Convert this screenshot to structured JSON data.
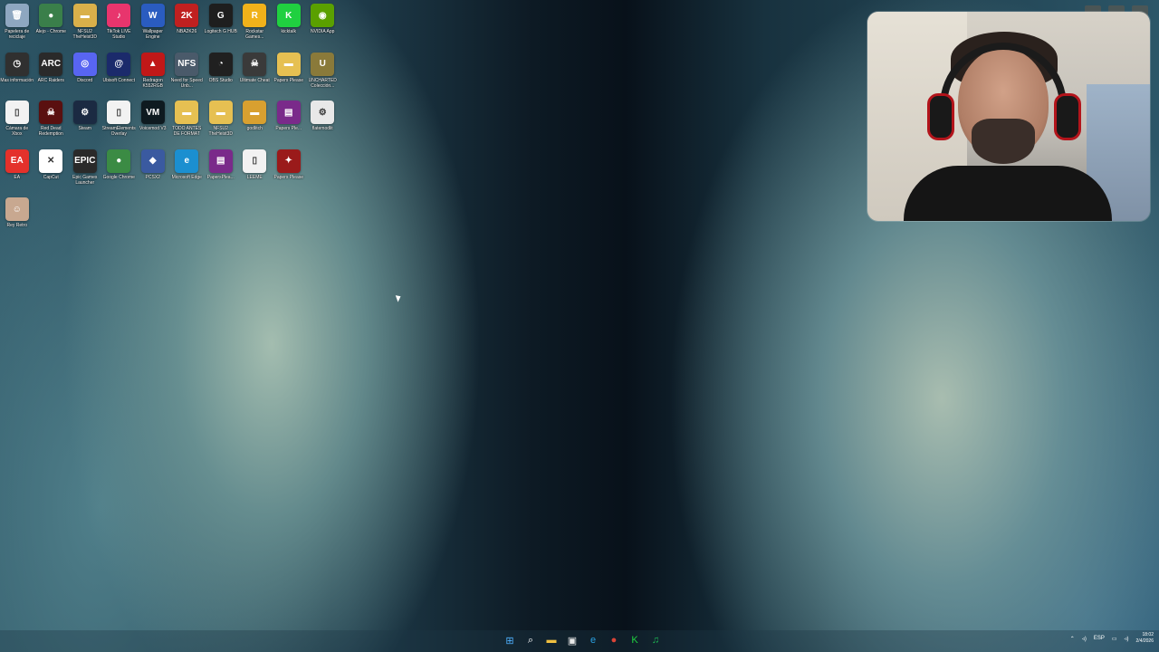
{
  "desktop": {
    "icons": [
      {
        "label": "Papelera de reciclaje",
        "icon": "recycle-bin-icon",
        "color": "#8ea7c0",
        "glyph": "🗑"
      },
      {
        "label": "Alejo - Chrome",
        "icon": "chrome-icon",
        "color": "#3a7f4a",
        "glyph": "●"
      },
      {
        "label": "NFSU2 TheHeist3D",
        "icon": "folder-icon",
        "color": "#d9b04a",
        "glyph": "▬"
      },
      {
        "label": "TikTok LIVE Studio",
        "icon": "tiktok-icon",
        "color": "#e8356d",
        "glyph": "♪"
      },
      {
        "label": "Wallpaper Engine",
        "icon": "wallpaper-engine-icon",
        "color": "#2a5cc0",
        "glyph": "W"
      },
      {
        "label": "NBA2K26",
        "icon": "nba2k-icon",
        "color": "#c02020",
        "glyph": "2K"
      },
      {
        "label": "Logitech G HUB",
        "icon": "logitech-icon",
        "color": "#1e1e1e",
        "glyph": "G"
      },
      {
        "label": "Rockstar Games...",
        "icon": "rockstar-icon",
        "color": "#f0b21a",
        "glyph": "R"
      },
      {
        "label": "kicktalk",
        "icon": "kick-icon",
        "color": "#20d040",
        "glyph": "K"
      },
      {
        "label": "NVIDIA App",
        "icon": "nvidia-icon",
        "color": "#5aa000",
        "glyph": "◉"
      },
      {
        "label": "Mas información",
        "icon": "clock-icon",
        "color": "#303030",
        "glyph": "◷"
      },
      {
        "label": "ARC Raiders",
        "icon": "arc-raiders-icon",
        "color": "#2a2a2a",
        "glyph": "ARC"
      },
      {
        "label": "Discord",
        "icon": "discord-icon",
        "color": "#5865f2",
        "glyph": "◎"
      },
      {
        "label": "Ubisoft Connect",
        "icon": "ubisoft-icon",
        "color": "#1b2a6b",
        "glyph": "@"
      },
      {
        "label": "Redragon K552RGB",
        "icon": "redragon-icon",
        "color": "#c01818",
        "glyph": "▲"
      },
      {
        "label": "Need for Speed Unb...",
        "icon": "nfs-icon",
        "color": "#4a5a6a",
        "glyph": "NFS"
      },
      {
        "label": "OBS Studio",
        "icon": "obs-icon",
        "color": "#202020",
        "glyph": "◔"
      },
      {
        "label": "Ultimate Cheat",
        "icon": "cheat-icon",
        "color": "#3a3a3a",
        "glyph": "☠"
      },
      {
        "label": "Papers Please",
        "icon": "folder-icon",
        "color": "#e6c052",
        "glyph": "▬"
      },
      {
        "label": "UNCHARTED Colección...",
        "icon": "uncharted-icon",
        "color": "#8a7a3a",
        "glyph": "U"
      },
      {
        "label": "Cámara de Xbox",
        "icon": "file-icon",
        "color": "#f2f2f2",
        "glyph": "▯"
      },
      {
        "label": "Red Dead Redemption",
        "icon": "rdr-icon",
        "color": "#5a1010",
        "glyph": "☠"
      },
      {
        "label": "Steam",
        "icon": "steam-icon",
        "color": "#1b2a42",
        "glyph": "⚙"
      },
      {
        "label": "StreamElements Overlay",
        "icon": "file-icon",
        "color": "#f2f2f2",
        "glyph": "▯"
      },
      {
        "label": "Voicemod V3",
        "icon": "voicemod-icon",
        "color": "#0e1a20",
        "glyph": "VM"
      },
      {
        "label": "TODO ANTES DE FORMAT",
        "icon": "folder-icon",
        "color": "#e6c052",
        "glyph": "▬"
      },
      {
        "label": "NFSU2 TheHeist3D",
        "icon": "folder-icon",
        "color": "#e6c052",
        "glyph": "▬"
      },
      {
        "label": "godlitch",
        "icon": "folder-icon",
        "color": "#d8a030",
        "glyph": "▬"
      },
      {
        "label": "Papers Ple...",
        "icon": "winrar-icon",
        "color": "#7a2a8a",
        "glyph": "▤"
      },
      {
        "label": "flatemodlit",
        "icon": "file-icon",
        "color": "#e8e8e8",
        "glyph": "⚙"
      },
      {
        "label": "EA",
        "icon": "ea-icon",
        "color": "#e4312b",
        "glyph": "EA"
      },
      {
        "label": "CapCut",
        "icon": "capcut-icon",
        "color": "#ffffff",
        "glyph": "✕"
      },
      {
        "label": "Epic Games Launcher",
        "icon": "epic-icon",
        "color": "#2a2a2a",
        "glyph": "EPIC"
      },
      {
        "label": "Google Chrome",
        "icon": "chrome-icon",
        "color": "#3b8b44",
        "glyph": "●"
      },
      {
        "label": "PCSX2",
        "icon": "pcsx2-icon",
        "color": "#3a5aa0",
        "glyph": "◆"
      },
      {
        "label": "Microsoft Edge",
        "icon": "edge-icon",
        "color": "#1b8fd0",
        "glyph": "e"
      },
      {
        "label": "PapersPlea...",
        "icon": "winrar-icon",
        "color": "#7a2a8a",
        "glyph": "▤"
      },
      {
        "label": "LEEME",
        "icon": "file-icon",
        "color": "#f2f2f2",
        "glyph": "▯"
      },
      {
        "label": "Papers Please",
        "icon": "papers-please-icon",
        "color": "#9a1a1a",
        "glyph": "✦"
      },
      {
        "label": "",
        "icon": "",
        "color": "",
        "glyph": ""
      },
      {
        "label": "Rey Retro",
        "icon": "game-icon",
        "color": "#c8a890",
        "glyph": "☺"
      }
    ]
  },
  "taskbar": {
    "items": [
      {
        "name": "start-button",
        "glyph": "⊞",
        "color": "#4fb0ff"
      },
      {
        "name": "search-button",
        "glyph": "⌕",
        "color": "#ffffff"
      },
      {
        "name": "file-explorer-button",
        "glyph": "▬",
        "color": "#f0c040"
      },
      {
        "name": "store-button",
        "glyph": "▣",
        "color": "#e8e8e8"
      },
      {
        "name": "edge-button",
        "glyph": "e",
        "color": "#2ba0e0"
      },
      {
        "name": "chrome-button",
        "glyph": "●",
        "color": "#db4437"
      },
      {
        "name": "kick-button",
        "glyph": "K",
        "color": "#20d040"
      },
      {
        "name": "spotify-button",
        "glyph": "♫",
        "color": "#1db954"
      }
    ],
    "tray": {
      "language": "ESP",
      "time": "18:02",
      "date": "2/4/2026"
    }
  }
}
